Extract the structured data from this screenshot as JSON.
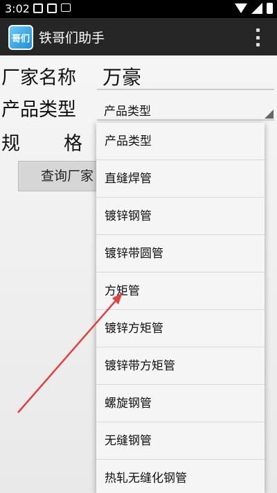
{
  "status": {
    "time": "3:02"
  },
  "app": {
    "title": "铁哥们助手",
    "icon_text": "哥们"
  },
  "form": {
    "manufacturer_label": "厂家名称",
    "manufacturer_value": "万豪",
    "product_type_label": "产品类型",
    "product_type_selected": "产品类型",
    "spec_label_left": "规",
    "spec_label_right": "格",
    "query_button": "查询厂家"
  },
  "dropdown": {
    "items": [
      "产品类型",
      "直缝焊管",
      "镀锌钢管",
      "镀锌带圆管",
      "方矩管",
      "镀锌方矩管",
      "镀锌带方矩管",
      "螺旋钢管",
      "无缝钢管",
      "热轧无缝化钢管"
    ]
  },
  "colors": {
    "annotation_arrow": "#e0413a"
  }
}
